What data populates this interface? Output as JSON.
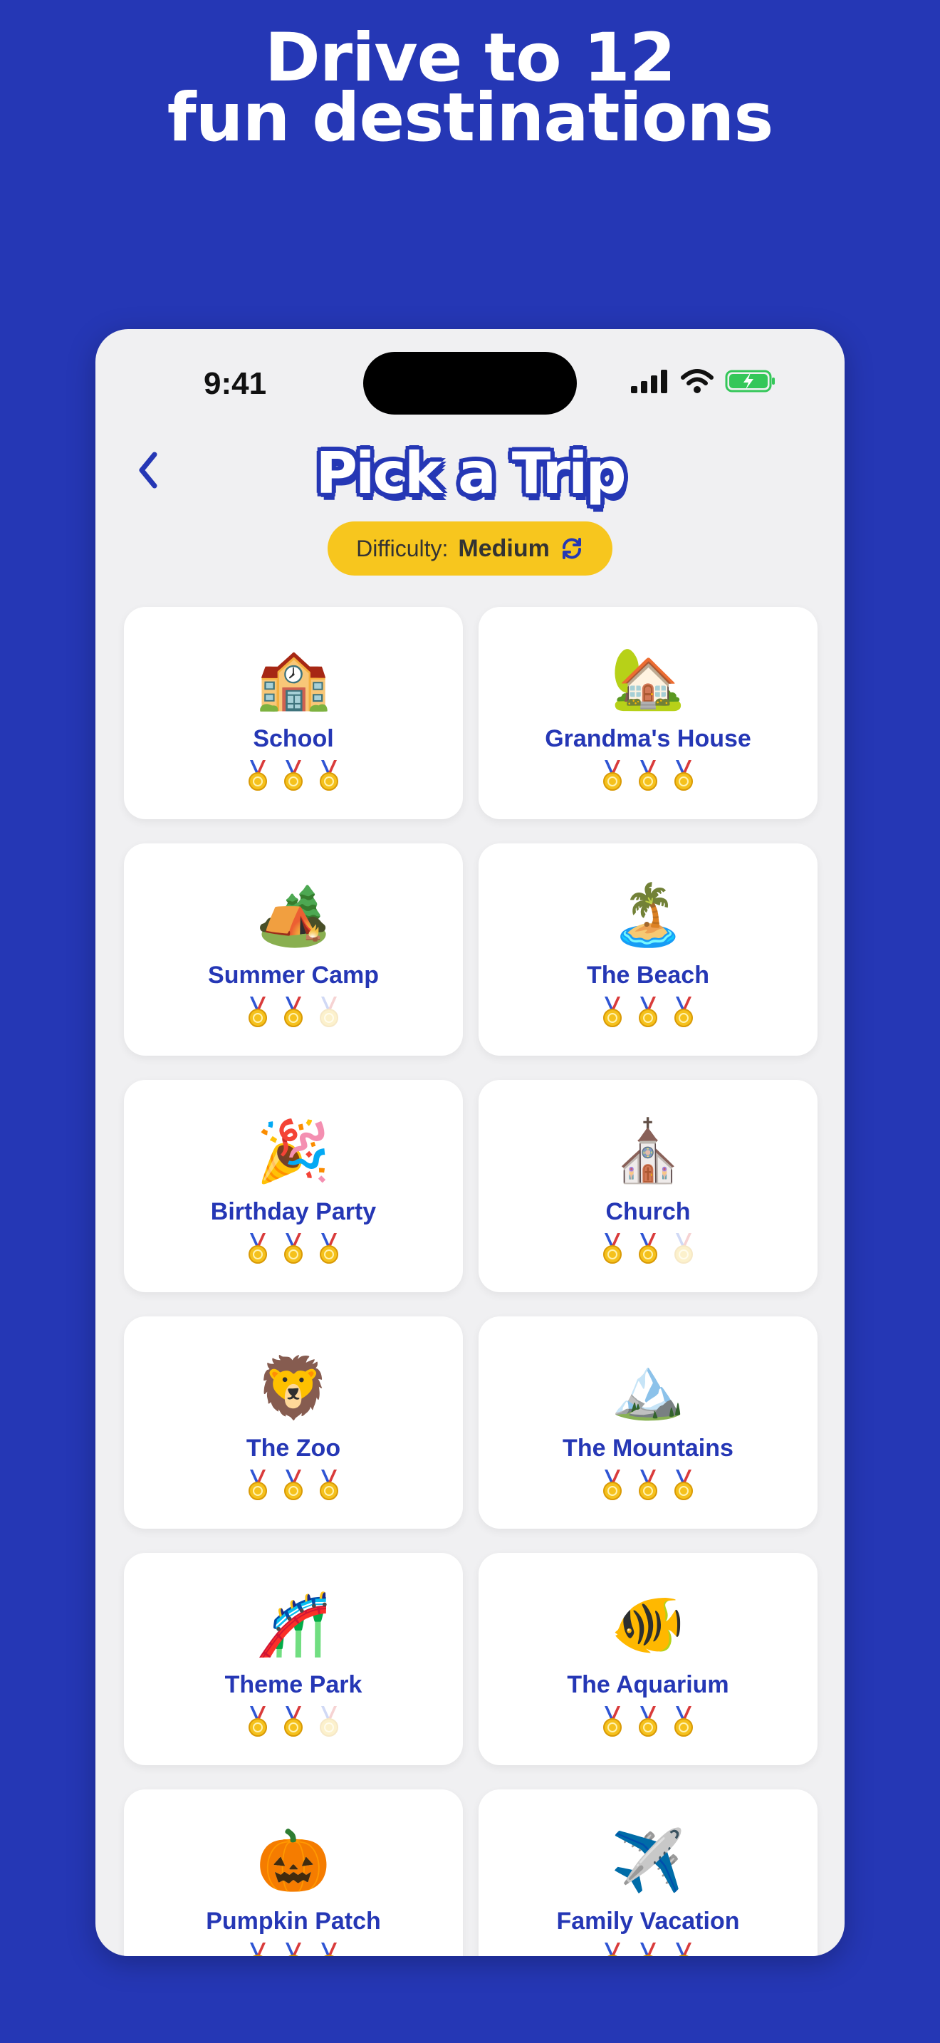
{
  "headline": {
    "line1": "Drive to 12",
    "line2": "fun destinations"
  },
  "status_bar": {
    "time": "9:41"
  },
  "nav": {
    "back_icon": "chevron-left-icon",
    "title": "Pick a Trip"
  },
  "difficulty": {
    "label": "Difficulty:",
    "value": "Medium",
    "icon": "refresh-icon"
  },
  "colors": {
    "background": "#2537b5",
    "accent": "#f7c61e",
    "card_text": "#2537b5"
  },
  "destinations": [
    {
      "name": "School",
      "emoji": "🏫",
      "medals": [
        true,
        true,
        true
      ]
    },
    {
      "name": "Grandma's House",
      "emoji": "🏡",
      "medals": [
        true,
        true,
        true
      ]
    },
    {
      "name": "Summer Camp",
      "emoji": "🏕️",
      "medals": [
        true,
        true,
        false
      ]
    },
    {
      "name": "The Beach",
      "emoji": "🏝️",
      "medals": [
        true,
        true,
        true
      ]
    },
    {
      "name": "Birthday Party",
      "emoji": "🎉",
      "medals": [
        true,
        true,
        true
      ]
    },
    {
      "name": "Church",
      "emoji": "⛪",
      "medals": [
        true,
        true,
        false
      ]
    },
    {
      "name": "The Zoo",
      "emoji": "🦁",
      "medals": [
        true,
        true,
        true
      ]
    },
    {
      "name": "The Mountains",
      "emoji": "🏔️",
      "medals": [
        true,
        true,
        true
      ]
    },
    {
      "name": "Theme Park",
      "emoji": "🎢",
      "medals": [
        true,
        true,
        false
      ]
    },
    {
      "name": "The Aquarium",
      "emoji": "🐠",
      "medals": [
        true,
        true,
        true
      ]
    },
    {
      "name": "Pumpkin Patch",
      "emoji": "🎃",
      "medals": [
        true,
        true,
        true
      ]
    },
    {
      "name": "Family Vacation",
      "emoji": "✈️",
      "medals": [
        true,
        true,
        true
      ]
    }
  ]
}
